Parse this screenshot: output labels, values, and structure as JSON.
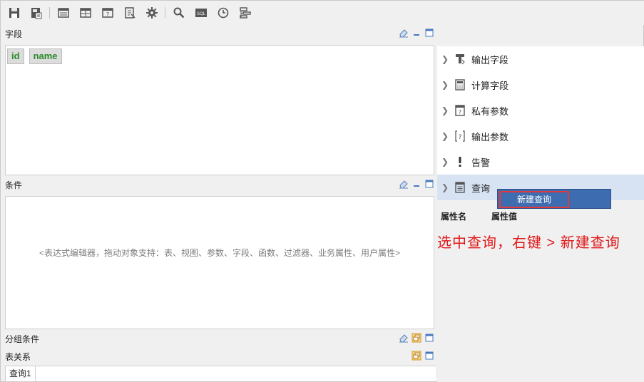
{
  "toolbar": {
    "icons": [
      "save-icon",
      "save-as-icon",
      "table-icon",
      "grid-icon",
      "param-icon",
      "export-icon",
      "gear-icon",
      "search-icon",
      "sql-icon",
      "clock-icon",
      "layout-icon"
    ],
    "sql_text": "SQL"
  },
  "fields_section": {
    "title": "字段",
    "chips": [
      "id",
      "name"
    ]
  },
  "conditions_section": {
    "title": "条件",
    "hint": "<表达式编辑器，拖动对象支持：表、视图、参数、字段、函数、过滤器、业务属性、用户属性>"
  },
  "group_section": {
    "title": "分组条件"
  },
  "relation_section": {
    "title": "表关系",
    "tabs": [
      "查询1"
    ]
  },
  "tree": {
    "items": [
      {
        "label": "输出字段",
        "icon": "output-field-icon"
      },
      {
        "label": "计算字段",
        "icon": "calculator-icon"
      },
      {
        "label": "私有参数",
        "icon": "private-param-icon"
      },
      {
        "label": "输出参数",
        "icon": "output-param-icon"
      },
      {
        "label": "告警",
        "icon": "alert-icon"
      },
      {
        "label": "查询",
        "icon": "query-icon"
      }
    ],
    "selected_index": 5
  },
  "context_menu": {
    "new_query": "新建查询"
  },
  "properties": {
    "name_header": "属性名",
    "value_header": "属性值"
  },
  "annotation": "选中查询，右键 > 新建查询",
  "colors": {
    "selection": "#d7e2f3",
    "menu_bg": "#3e6cb0",
    "annotation": "#e0191a",
    "chip_text": "#2a8a2a"
  }
}
